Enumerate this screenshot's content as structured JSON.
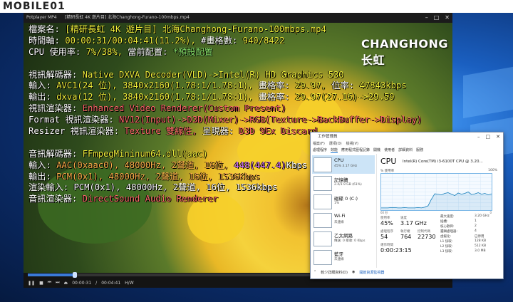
{
  "brand": "MOBILE01",
  "player": {
    "app_name": "Potplayer",
    "format": "MP4",
    "title": "[精研長虹 4K 遊片目] 北海Changhong-Furano-100mbps.mp4",
    "time_current": "00:00:31",
    "time_total": "00:04:41",
    "seek_fraction": 0.112,
    "codec_label": "H/W",
    "logo_text": "CHANGHONG长虹"
  },
  "osd": [
    [
      {
        "t": "檔案名: ",
        "c": "c-w"
      },
      {
        "t": "[精研長虹 4K 遊片目] 北海Changhong-Furano-100mbps.mp4",
        "c": "c-y"
      }
    ],
    [
      {
        "t": "時間軸: ",
        "c": "c-w"
      },
      {
        "t": "00:00:31/00:04:41(11.2%), ",
        "c": "c-y"
      },
      {
        "t": "#畫格數: ",
        "c": "c-w"
      },
      {
        "t": "940/8422",
        "c": "c-y"
      }
    ],
    [
      {
        "t": "CPU 使用率: ",
        "c": "c-w"
      },
      {
        "t": "7%/38%, ",
        "c": "c-y"
      },
      {
        "t": "當前配置: ",
        "c": "c-w"
      },
      {
        "t": "*預設配置",
        "c": "c-g"
      }
    ],
    [
      {
        "t": "",
        "c": "c-w"
      }
    ],
    [
      {
        "t": "視訊解碼器: ",
        "c": "c-w"
      },
      {
        "t": "Native DXVA Decoder(VLD)->Intel(R) HD Graphics 530",
        "c": "c-y"
      }
    ],
    [
      {
        "t": "輸入: ",
        "c": "c-w"
      },
      {
        "t": "AVC1(24 位), 3840x2160(1.78:1/1.78:1), ",
        "c": "c-y"
      },
      {
        "t": "畫格率: ",
        "c": "c-w"
      },
      {
        "t": "29.97, ",
        "c": "c-y"
      },
      {
        "t": "位率: ",
        "c": "c-w"
      },
      {
        "t": "47843kbps",
        "c": "c-y"
      }
    ],
    [
      {
        "t": "輸出: ",
        "c": "c-w"
      },
      {
        "t": "dxva(12 位), 3840x2160(1.78:1/1.78:1), ",
        "c": "c-y"
      },
      {
        "t": "畫格率: ",
        "c": "c-w"
      },
      {
        "t": "29.97(27.16)->29.59",
        "c": "c-y"
      }
    ],
    [
      {
        "t": "視訊渲染器: ",
        "c": "c-w"
      },
      {
        "t": "Enhanced Video Renderer(Custom Present)",
        "c": "c-r"
      }
    ],
    [
      {
        "t": "Format 視訊渲染器: ",
        "c": "c-w"
      },
      {
        "t": "NV12(Input)->D3D(Mixer)->RGB(Texture->BackBuffer->Display)",
        "c": "c-r"
      }
    ],
    [
      {
        "t": "Resizer 視訊渲染器: ",
        "c": "c-w"
      },
      {
        "t": "Texture 雙線性, ",
        "c": "c-r"
      },
      {
        "t": "呈現器: ",
        "c": "c-w"
      },
      {
        "t": "D3D 9Ex Discard",
        "c": "c-r"
      }
    ],
    [
      {
        "t": "",
        "c": "c-w"
      }
    ],
    [
      {
        "t": "音訊解碼器: ",
        "c": "c-w"
      },
      {
        "t": "FFmpegMininum64.dll(aac)",
        "c": "c-y"
      }
    ],
    [
      {
        "t": "輸入: ",
        "c": "c-w"
      },
      {
        "t": "AAC(0xaac0), 48000Hz, 2聲道, 16位, ",
        "c": "c-o"
      },
      {
        "t": "448(447.4)",
        "c": "c-m"
      },
      {
        "t": "Kbps",
        "c": "c-w"
      }
    ],
    [
      {
        "t": "輸出: ",
        "c": "c-w"
      },
      {
        "t": "PCM(0x1), 48000Hz, 2聲道, 16位, 1536Kbps",
        "c": "c-o"
      }
    ],
    [
      {
        "t": "渲染輸入: ",
        "c": "c-w"
      },
      {
        "t": "PCM(0x1), 48000Hz, 2聲道, 16位, 1536kbps",
        "c": "c-w"
      }
    ],
    [
      {
        "t": "音訊渲染器: ",
        "c": "c-w"
      },
      {
        "t": "DirectSound Audio Renderer",
        "c": "c-r"
      }
    ]
  ],
  "taskmgr": {
    "title": "工作管理員",
    "menu": [
      "檔案(F)",
      "選項(O)",
      "檢視(V)"
    ],
    "tabs": [
      "處理程序",
      "效能",
      "應用程式歷程記錄",
      "開機",
      "使用者",
      "詳細資料",
      "服務"
    ],
    "active_tab": 1,
    "resources": [
      {
        "name": "CPU",
        "sub": "45%  3.17 GHz"
      },
      {
        "name": "記憶體",
        "sub": "2.4/3.9 GB (61%)"
      },
      {
        "name": "磁碟 0 (C:)",
        "sub": "1%"
      },
      {
        "name": "Wi-Fi",
        "sub": "未連線"
      },
      {
        "name": "乙太網路",
        "sub": "傳送: 0 接收: 0 Kbps"
      },
      {
        "name": "藍牙",
        "sub": "未連線"
      }
    ],
    "cpu_title": "CPU",
    "cpu_model": "Intel(R) Core(TM) i3-6100T CPU @ 3.20...",
    "graph_label": "% 使用率",
    "graph_max": "100%",
    "graph_seconds": "60 秒",
    "graph_zero": "0",
    "graph_series": [
      6,
      6,
      6,
      7,
      7,
      6,
      6,
      7,
      6,
      6,
      6,
      7,
      6,
      8,
      12,
      30,
      45,
      44,
      42,
      46,
      48,
      44,
      40,
      47,
      44,
      46,
      50,
      43,
      45,
      48,
      44,
      46,
      42,
      45
    ],
    "stats": {
      "usage_label": "使用率",
      "usage": "45%",
      "speed_label": "速度",
      "speed": "3.17 GHz",
      "proc_label": "處理程序",
      "proc": "54",
      "threads_label": "執行緒",
      "threads": "764",
      "handles_label": "控制代碼",
      "handles": "22730",
      "uptime_label": "運作時間",
      "uptime": "0:00:23:15"
    },
    "specs": [
      [
        "最大速度:",
        "3.20 GHz"
      ],
      [
        "插槽:",
        "1"
      ],
      [
        "核心數目:",
        "2"
      ],
      [
        "邏輯處理器:",
        "4"
      ],
      [
        "虛擬化:",
        "已停用"
      ],
      [
        "L1 快取:",
        "128 KB"
      ],
      [
        "L2 快取:",
        "512 KB"
      ],
      [
        "L3 快取:",
        "3.0 MB"
      ]
    ],
    "footer_less": "較少詳細資料(D)",
    "footer_monitor": "開啟資源監視器"
  }
}
